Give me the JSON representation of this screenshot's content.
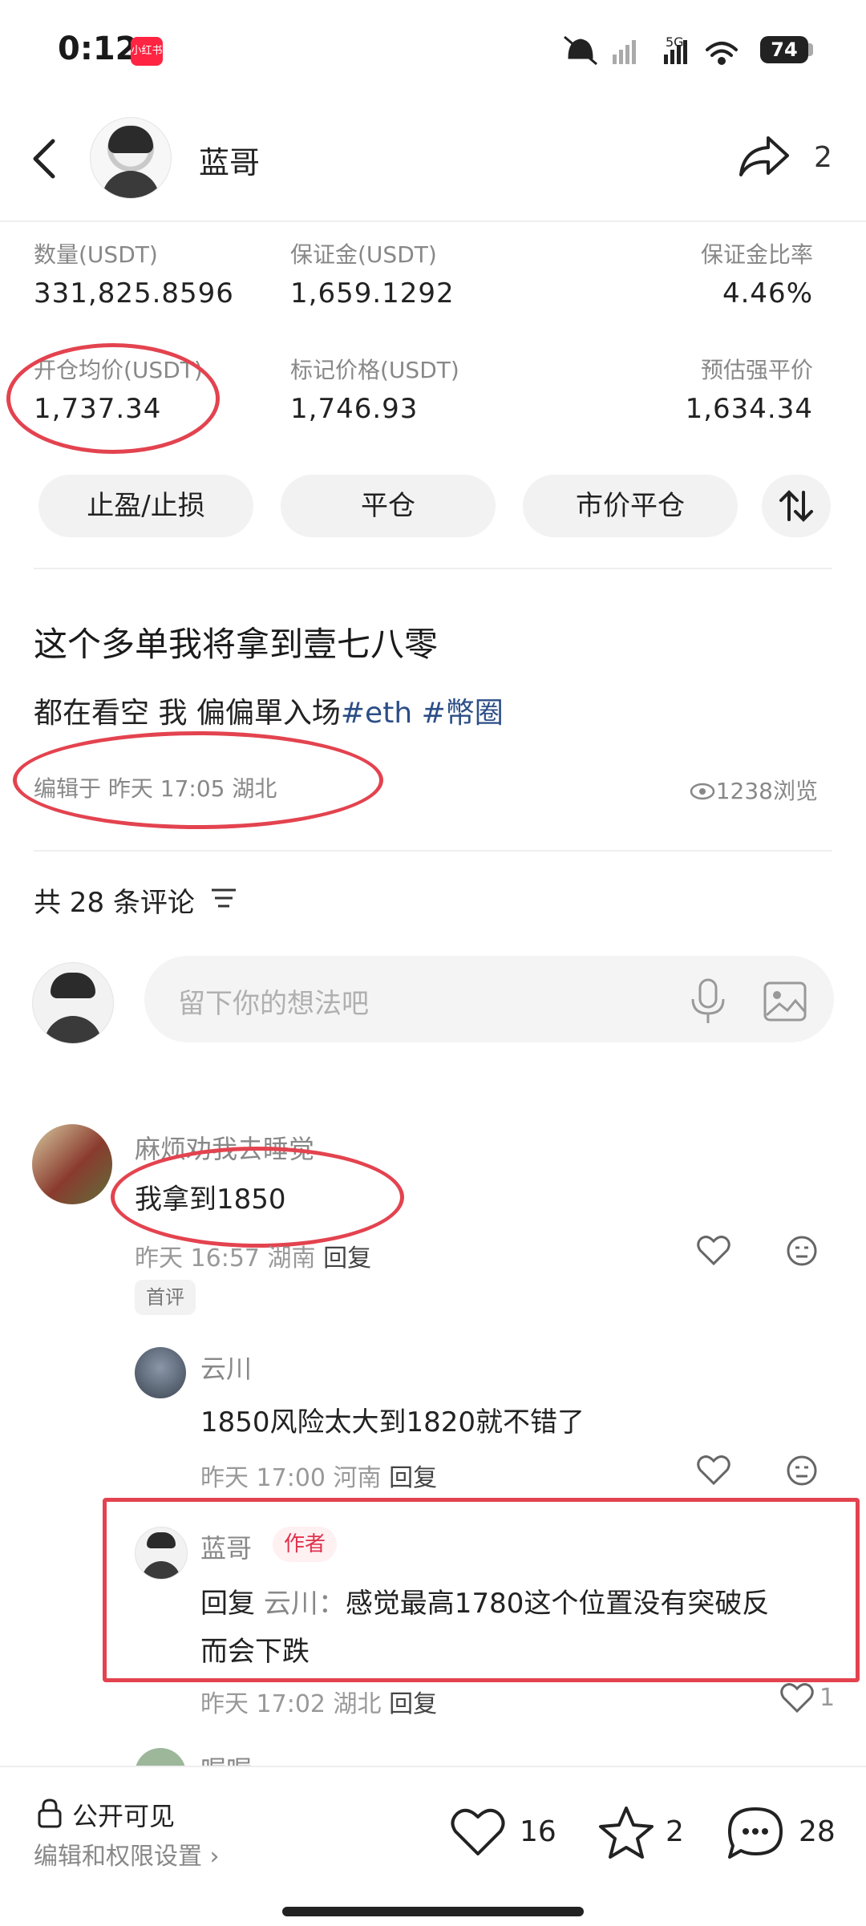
{
  "status_bar": {
    "time": "0:12",
    "app_badge": "小红书",
    "network": "5G",
    "battery": "74"
  },
  "header": {
    "author": "蓝哥",
    "share_count": "2"
  },
  "position": {
    "qty_label": "数量(USDT)",
    "qty_value": "331,825.8596",
    "margin_label": "保证金(USDT)",
    "margin_value": "1,659.1292",
    "margin_ratio_label": "保证金比率",
    "margin_ratio_value": "4.46%",
    "entry_label": "开仓均价(USDT)",
    "entry_value": "1,737.34",
    "mark_label": "标记价格(USDT)",
    "mark_value": "1,746.93",
    "liq_label": "预估强平价",
    "liq_value": "1,634.34",
    "buttons": [
      "止盈/止损",
      "平仓",
      "市价平仓"
    ]
  },
  "post": {
    "title": "这个多单我将拿到壹七八零",
    "body": "都在看空 我 偏偏單入场",
    "tags": [
      "#eth",
      "#幣圈"
    ],
    "meta": "编辑于 昨天 17:05 湖北",
    "views": "1238浏览"
  },
  "comments_header": {
    "count_text": "共 28 条评论"
  },
  "comment_input": {
    "placeholder": "留下你的想法吧"
  },
  "comments": [
    {
      "name": "麻烦劝我去睡觉",
      "text": "我拿到1850",
      "meta": "昨天 16:57 湖南",
      "reply": "回复",
      "badge": "首评"
    },
    {
      "name": "云川",
      "text": "1850风险太大到1820就不错了",
      "meta": "昨天 17:00 河南",
      "reply": "回复"
    },
    {
      "name": "蓝哥",
      "badge": "作者",
      "reply_prefix": "回复",
      "reply_to": "云川",
      "text_line1": "感觉最高1780这个位置没有突破反",
      "text_line2": "而会下跌",
      "meta": "昨天 17:02 湖北",
      "reply": "回复",
      "likes": "1"
    },
    {
      "name": "喔喔"
    }
  ],
  "bottom_bar": {
    "visibility": "公开可见",
    "settings": "编辑和权限设置",
    "likes": "16",
    "favorites": "2",
    "comments": "28"
  }
}
